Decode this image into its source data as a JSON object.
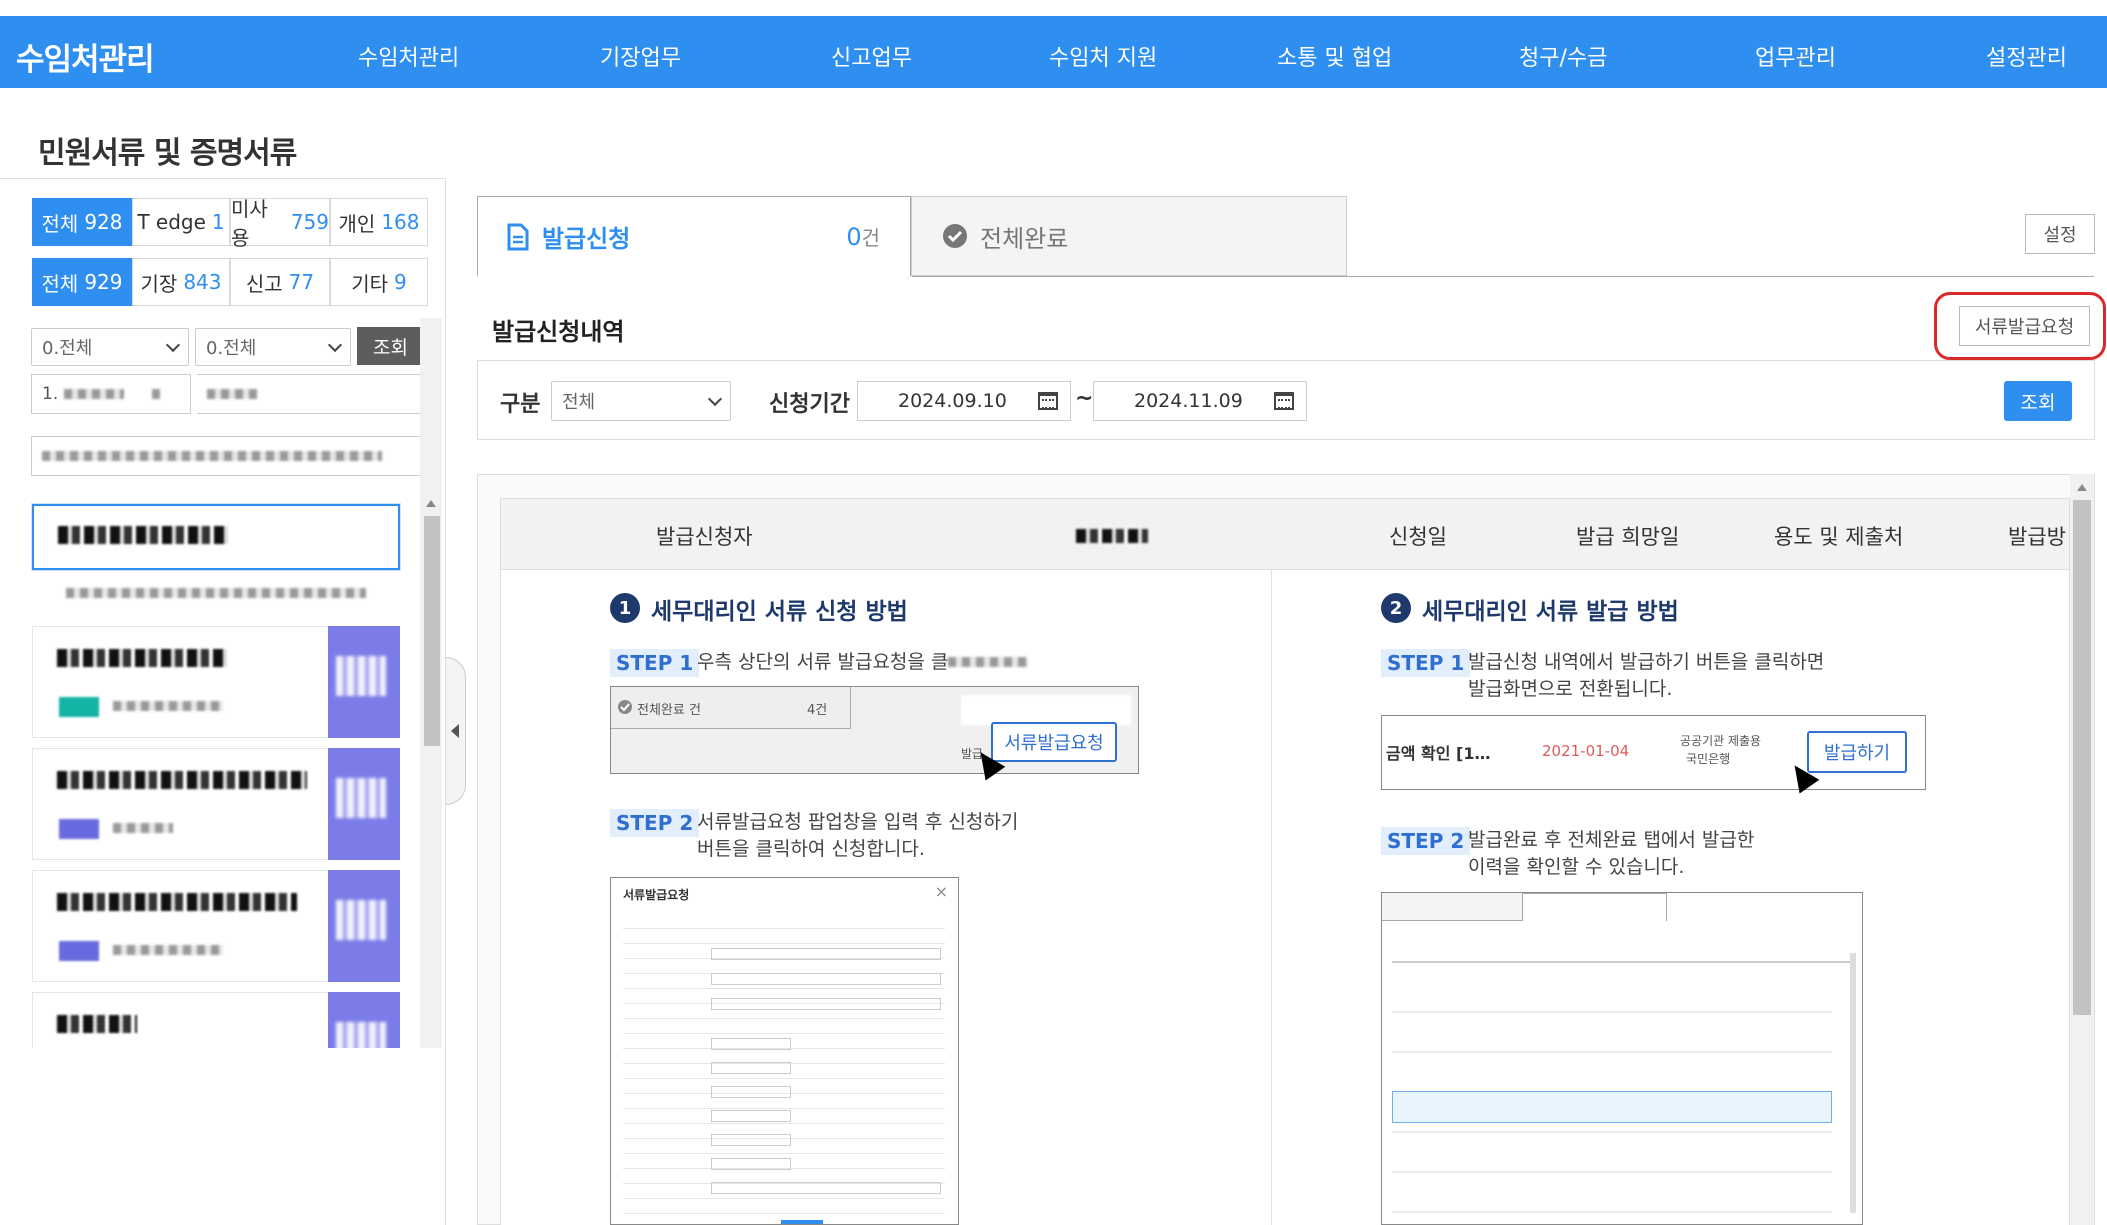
{
  "app": {
    "title": "수임처관리"
  },
  "nav": [
    "수임처관리",
    "기장업무",
    "신고업무",
    "수임처 지원",
    "소통 및 협업",
    "청구/수금",
    "업무관리",
    "설정관리"
  ],
  "page": {
    "title": "민원서류 및 증명서류"
  },
  "left": {
    "row1": [
      {
        "label": "전체",
        "count": "928"
      },
      {
        "label": "T edge",
        "count": "1"
      },
      {
        "label": "미사용",
        "count": "759"
      },
      {
        "label": "개인",
        "count": "168"
      }
    ],
    "row2": [
      {
        "label": "전체",
        "count": "929"
      },
      {
        "label": "기장",
        "count": "843"
      },
      {
        "label": "신고",
        "count": "77"
      },
      {
        "label": "기타",
        "count": "9"
      }
    ],
    "select1": "0.전체",
    "select2": "0.전체",
    "search_button": "조회",
    "input1_prefix": "1."
  },
  "tabs": {
    "request": {
      "label": "발급신청",
      "count": "0",
      "unit": "건"
    },
    "done": {
      "label": "전체완료"
    }
  },
  "settings_button": "설정",
  "section": {
    "title": "발급신청내역",
    "request_button": "서류발급요청"
  },
  "filter": {
    "type_label": "구분",
    "type_value": "전체",
    "period_label": "신청기간",
    "date_from": "2024.09.10",
    "tilde": "~",
    "date_to": "2024.11.09",
    "search_button": "조회"
  },
  "table": {
    "headers": [
      "발급신청자",
      "신청일",
      "발급 희망일",
      "용도 및 제출처",
      "발급방"
    ]
  },
  "guide": {
    "left": {
      "num": "1",
      "title": "세무대리인 서류 신청 방법",
      "step1_badge": "STEP 1",
      "step1_text": "우측 상단의 서류 발급요청을 클",
      "mini_tab": "전체완료 건",
      "mini_count": "4건",
      "mini_small": "발급",
      "mini_button": "서류발급요청",
      "step2_badge": "STEP 2",
      "step2_text1": "서류발급요청 팝업창을 입력 후 신청하기",
      "step2_text2": "버튼을 클릭하여 신청합니다.",
      "popup_title": "서류발급요청",
      "popup_close": "×"
    },
    "right": {
      "num": "2",
      "title": "세무대리인 서류 발급 방법",
      "step1_badge": "STEP 1",
      "step1_text1": "발급신청 내역에서 발급하기 버튼을 클릭하면",
      "step1_text2": "발급화면으로 전환됩니다.",
      "mini_left": "금액 확인 [1…",
      "mini_date": "2021-01-04",
      "mini_org1": "공공기관 제출용",
      "mini_org2": "국민은행",
      "mini_button": "발급하기",
      "step2_badge": "STEP 2",
      "step2_text1": "발급완료 후 전체완료 탭에서 발급한",
      "step2_text2": "이력을 확인할 수 있습니다."
    }
  },
  "colors": {
    "brand": "#2f8ff0",
    "highlight": "#d92a2a",
    "guide_title": "#1e3a6d",
    "card_badge": "#7c7ce8"
  }
}
